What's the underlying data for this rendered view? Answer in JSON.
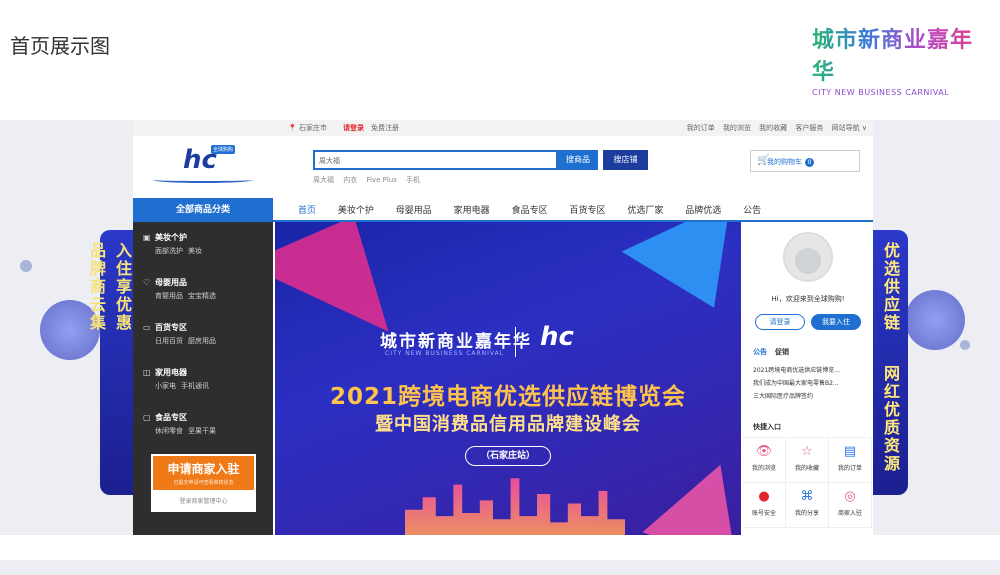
{
  "page_title": "首页展示图",
  "brand_logo": {
    "cn": "城市新商业嘉年华",
    "en": "CITY NEW BUSINESS CARNIVAL"
  },
  "side_left": {
    "col1": "入住享优惠",
    "col2": "品牌商云集"
  },
  "side_right": {
    "col1": "优选供应链",
    "col2": "网红优质资源"
  },
  "topbar": {
    "location": "石家庄市",
    "login": "请登录",
    "register": "免费注册",
    "links": [
      "我的订单",
      "我的浏览",
      "我的收藏",
      "客户服务",
      "网站导航 ∨"
    ]
  },
  "site_logo": {
    "mark": "hc",
    "tag": "全球购购"
  },
  "search": {
    "placeholder": "周大福",
    "btn_goods": "搜商品",
    "btn_store": "搜店铺",
    "hot": [
      "周大福",
      "内衣",
      "Five Plus",
      "手机"
    ]
  },
  "cart": {
    "label": "我的购物车",
    "count": "0"
  },
  "nav": {
    "category_head": "全部商品分类",
    "items": [
      "首页",
      "美妆个护",
      "母婴用品",
      "家用电器",
      "食品专区",
      "百货专区",
      "优选厂家",
      "品牌优选",
      "公告"
    ]
  },
  "categories": [
    {
      "title": "美妆个护",
      "icon": "cosmetics-icon",
      "subs": [
        "面部洗护",
        "美妆"
      ]
    },
    {
      "title": "母婴用品",
      "icon": "baby-icon",
      "subs": [
        "育婴用品",
        "宝宝精选"
      ]
    },
    {
      "title": "百货专区",
      "icon": "store-icon",
      "subs": [
        "日用百货",
        "厨房用品"
      ]
    },
    {
      "title": "家用电器",
      "icon": "appliance-icon",
      "subs": [
        "小家电",
        "手机通讯"
      ]
    },
    {
      "title": "食品专区",
      "icon": "food-icon",
      "subs": [
        "休闲零食",
        "坚果干果"
      ]
    }
  ],
  "apply": {
    "title": "申请商家入驻",
    "sub": "已提交申请可查看审核状态",
    "manage": "登录商家管理中心"
  },
  "banner": {
    "logo_cn": "城市新商业嘉年华",
    "logo_en": "CITY NEW BUSINESS CARNIVAL",
    "logo2": "hc",
    "headline": "2021跨境电商优选供应链博览会",
    "subhead": "暨中国消费品信用品牌建设峰会",
    "station": "（石家庄站）"
  },
  "user_panel": {
    "welcome": "Hi，欢迎来到全球购购!",
    "login_btn": "请登录",
    "join_btn": "我要入住",
    "tab_notice": "公告",
    "tab_promo": "促销",
    "notices": [
      "2021跨境电商优选供应链博览...",
      "我们成为中国最大家电零售B2...",
      "三大国际医疗品牌签约"
    ],
    "quick_title": "快捷入口",
    "quick": [
      {
        "label": "我的浏览",
        "icon": "browse-icon",
        "glyph": "👁",
        "color": "#e35a8a"
      },
      {
        "label": "我的收藏",
        "icon": "star-icon",
        "glyph": "☆",
        "color": "#e35a8a"
      },
      {
        "label": "我的订单",
        "icon": "order-icon",
        "glyph": "▤",
        "color": "#2d78e0"
      },
      {
        "label": "账号安全",
        "icon": "security-icon",
        "glyph": "●",
        "color": "#e3262d"
      },
      {
        "label": "我的分享",
        "icon": "share-icon",
        "glyph": "⌘",
        "color": "#2d78e0"
      },
      {
        "label": "商家入驻",
        "icon": "merchant-icon",
        "glyph": "◎",
        "color": "#e35a8a"
      }
    ]
  }
}
